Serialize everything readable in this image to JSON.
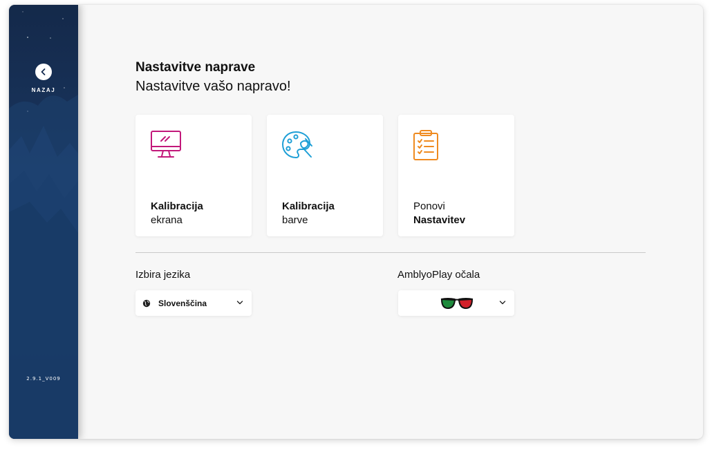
{
  "sidebar": {
    "back_label": "NAZAJ",
    "version": "2.9.1_V009"
  },
  "header": {
    "title": "Nastavitve naprave",
    "subtitle": "Nastavitve vašo napravo!"
  },
  "cards": [
    {
      "line1": "Kalibracija",
      "line2": "ekrana",
      "icon": "monitor-icon",
      "color": "#c2187a"
    },
    {
      "line1": "Kalibracija",
      "line2": "barve",
      "icon": "palette-icon",
      "color": "#1e9fd6"
    },
    {
      "line1": "Ponovi",
      "line2": "Nastavitev",
      "icon": "clipboard-checklist-icon",
      "color": "#ef8a1f"
    }
  ],
  "language": {
    "label": "Izbira jezika",
    "selected": "Slovenščina"
  },
  "glasses": {
    "label": "AmblyoPlay očala",
    "left_lens_color": "#1e8a3c",
    "right_lens_color": "#d2202a"
  }
}
